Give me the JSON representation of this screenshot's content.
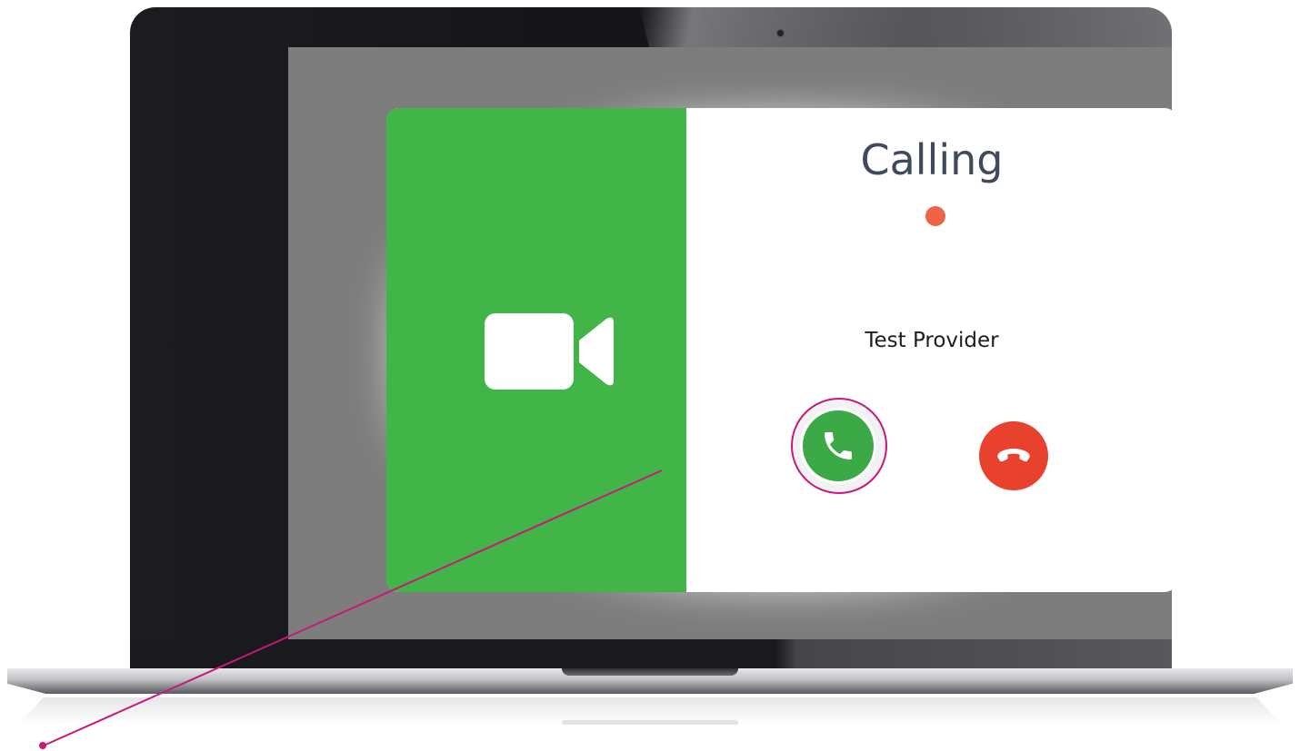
{
  "call": {
    "status_title": "Calling",
    "caller_name": "Test Provider"
  },
  "icons": {
    "video": "video-camera-icon",
    "answer": "phone-icon",
    "decline": "phone-hangup-icon"
  },
  "colors": {
    "video_panel": "#42b549",
    "answer_button": "#3aa946",
    "decline_button": "#e8412e",
    "status_dot": "#ef6346",
    "callout": "#c8197a",
    "screen_background": "#7d7d7d"
  }
}
